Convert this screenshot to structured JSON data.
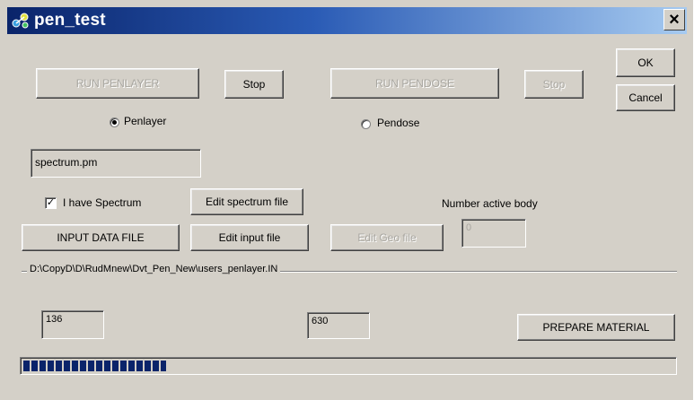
{
  "window": {
    "title": "pen_test",
    "close_label": "×"
  },
  "buttons": {
    "run_penlayer": "RUN PENLAYER",
    "stop_penlayer": "Stop",
    "run_pendose": "RUN PENDOSE",
    "stop_pendose": "Stop",
    "ok": "OK",
    "cancel": "Cancel",
    "edit_spectrum_file": "Edit spectrum file",
    "input_data_file": "INPUT DATA FILE",
    "edit_input_file": "Edit input file",
    "edit_geo_file": "Edit Geo file",
    "prepare_material": "PREPARE MATERIAL"
  },
  "radios": {
    "penlayer_label": "Penlayer",
    "penlayer_checked": true,
    "pendose_label": "Pendose",
    "pendose_checked": false
  },
  "fields": {
    "spectrum_file": "spectrum.pm",
    "number_active_body_label": "Number active body",
    "number_active_body": "0",
    "value_left": "136",
    "value_right": "630"
  },
  "checkbox": {
    "label": "I have Spectrum",
    "checked": true,
    "mark": "✓"
  },
  "path": {
    "text": "D:\\CopyD\\D\\RudMnew\\Dvt_Pen_New\\users_penlayer.IN"
  },
  "progress": {
    "fraction": 0.22
  },
  "icons": {
    "app": "app-icon",
    "close": "close-icon"
  }
}
